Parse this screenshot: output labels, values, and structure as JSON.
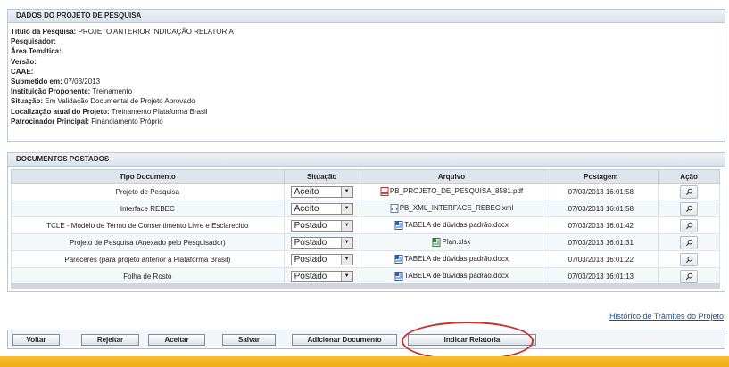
{
  "project": {
    "header": "DADOS DO PROJETO DE PESQUISA",
    "fields": [
      {
        "label": "Título da Pesquisa:",
        "value": "PROJETO ANTERIOR INDICAÇÃO RELATORIA"
      },
      {
        "label": "Pesquisador:",
        "value": ""
      },
      {
        "label": "Área Temática:",
        "value": ""
      },
      {
        "label": "Versão:",
        "value": ""
      },
      {
        "label": "CAAE:",
        "value": ""
      },
      {
        "label": "Submetido em:",
        "value": "07/03/2013"
      },
      {
        "label": "Instituição Proponente:",
        "value": "Treinamento"
      },
      {
        "label": "Situação:",
        "value": "Em Validação Documental de Projeto Aprovado"
      },
      {
        "label": "Localização atual do Projeto:",
        "value": "Treinamento Plataforma Brasil"
      },
      {
        "label": "Patrocinador Principal:",
        "value": "Financiamento Próprio"
      }
    ]
  },
  "documents": {
    "header": "DOCUMENTOS POSTADOS",
    "columns": [
      "Tipo Documento",
      "Situação",
      "Arquivo",
      "Postagem",
      "Ação"
    ],
    "rows": [
      {
        "tipo": "Projeto de Pesquisa",
        "situacao": "Aceito",
        "arquivo": "PB_PROJETO_DE_PESQUISA_8581.pdf",
        "icon": "pdf-file-icon",
        "postagem": "07/03/2013 16:01:58"
      },
      {
        "tipo": "Interface REBEC",
        "situacao": "Aceito",
        "arquivo": "PB_XML_INTERFACE_REBEC.xml",
        "icon": "xml-file-icon",
        "postagem": "07/03/2013 16:01:58"
      },
      {
        "tipo": "TCLE - Modelo de Termo de Consentimento Livre e Esclarecido",
        "situacao": "Postado",
        "arquivo": "TABELA de dúvidas padrão.docx",
        "icon": "word-file-icon",
        "postagem": "07/03/2013 16:01:42"
      },
      {
        "tipo": "Projeto de Pesquisa (Anexado pelo Pesquisador)",
        "situacao": "Postado",
        "arquivo": "Plan.xlsx",
        "icon": "excel-file-icon",
        "postagem": "07/03/2013 16:01:31"
      },
      {
        "tipo": "Pareceres (para projeto anterior à Plataforma Brasil)",
        "situacao": "Postado",
        "arquivo": "TABELA de dúvidas padrão.docx",
        "icon": "word-file-icon",
        "postagem": "07/03/2013 16:01:22"
      },
      {
        "tipo": "Folha de Rosto",
        "situacao": "Postado",
        "arquivo": "TABELA de dúvidas padrão.docx",
        "icon": "word-file-icon",
        "postagem": "07/03/2013 16:01:13"
      }
    ]
  },
  "links": {
    "historico": "Histórico de Trâmites do Projeto"
  },
  "buttons": {
    "voltar": "Voltar",
    "rejeitar": "Rejeitar",
    "aceitar": "Aceitar",
    "salvar": "Salvar",
    "adicionar": "Adicionar Documento",
    "indicar": "Indicar Relatoria"
  },
  "colors": {
    "highlight_ellipse": "#c8302b",
    "footer_stripe": "#f0a91e",
    "link": "#1a4f9c"
  }
}
